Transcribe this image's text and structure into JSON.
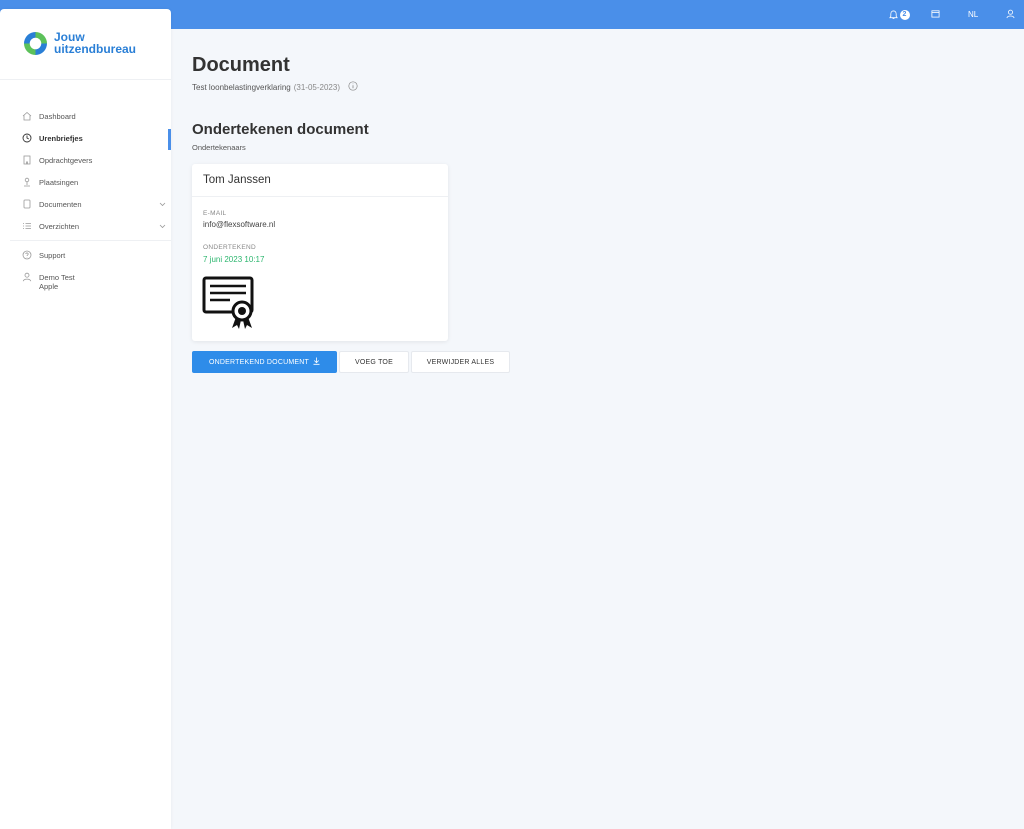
{
  "topbar": {
    "notification_count": "2",
    "language": "NL"
  },
  "brand": {
    "line1": "Jouw",
    "line2": "uitzendbureau",
    "color": "#2a7fd6"
  },
  "sidebar": {
    "items": [
      {
        "label": "Dashboard",
        "icon": "home-icon"
      },
      {
        "label": "Urenbriefjes",
        "icon": "clock-icon",
        "active": true
      },
      {
        "label": "Opdrachtgevers",
        "icon": "building-icon"
      },
      {
        "label": "Plaatsingen",
        "icon": "pin-icon"
      },
      {
        "label": "Documenten",
        "icon": "document-icon",
        "expandable": true
      },
      {
        "label": "Overzichten",
        "icon": "list-icon",
        "expandable": true
      }
    ],
    "support": {
      "label": "Support",
      "icon": "question-icon"
    },
    "user": {
      "name": "Demo Test",
      "company": "Apple",
      "icon": "user-icon"
    }
  },
  "page": {
    "title": "Document",
    "doc_name": "Test loonbelastingverklaring",
    "doc_date": "(31-05-2023)"
  },
  "section": {
    "title": "Ondertekenen document",
    "subtitle": "Ondertekenaars"
  },
  "signer": {
    "name": "Tom Janssen",
    "email_label": "E-MAIL",
    "email": "info@flexsoftware.nl",
    "signed_label": "ONDERTEKEND",
    "signed_at": "7 juni 2023 10:17",
    "signed_color": "#2cb66e"
  },
  "buttons": {
    "download": "ONDERTEKEND DOCUMENT",
    "add": "VOEG TOE",
    "delete_all": "VERWIJDER ALLES"
  },
  "colors": {
    "accent": "#4a8fe9",
    "primary_button": "#2e8ce9"
  }
}
